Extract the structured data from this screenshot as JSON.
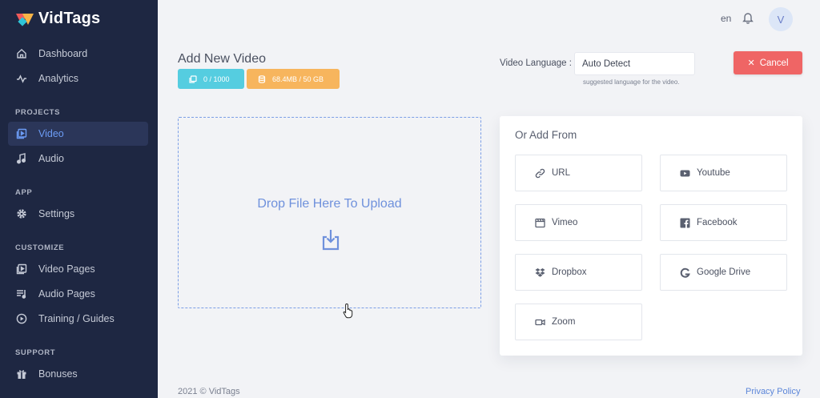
{
  "app": {
    "name": "VidTags"
  },
  "sidebar": {
    "items": [
      {
        "label": "Dashboard",
        "icon": "home-icon"
      },
      {
        "label": "Analytics",
        "icon": "pulse-icon"
      },
      {
        "label": "Video",
        "icon": "video-library-icon",
        "active": true
      },
      {
        "label": "Audio",
        "icon": "music-note-icon"
      },
      {
        "label": "Settings",
        "icon": "gear-icon"
      },
      {
        "label": "Video Pages",
        "icon": "video-pages-icon"
      },
      {
        "label": "Audio Pages",
        "icon": "playlist-icon"
      },
      {
        "label": "Training / Guides",
        "icon": "play-circle-icon"
      },
      {
        "label": "Bonuses",
        "icon": "gift-icon"
      }
    ],
    "sections": {
      "projects": "PROJECTS",
      "app": "APP",
      "customize": "CUSTOMIZE",
      "support": "SUPPORT"
    }
  },
  "topbar": {
    "language_code": "en",
    "avatar_initial": "V"
  },
  "header": {
    "title": "Add New Video",
    "video_count": "0 / 1000",
    "storage": "68.4MB / 50 GB",
    "video_language_label": "Video Language :",
    "video_language_value": "Auto Detect",
    "video_language_hint": "suggested language for the video.",
    "cancel_label": "Cancel"
  },
  "dropzone": {
    "text": "Drop File Here To Upload"
  },
  "add_from": {
    "title": "Or Add From",
    "sources": [
      {
        "label": "URL",
        "icon": "link-icon"
      },
      {
        "label": "Youtube",
        "icon": "youtube-icon"
      },
      {
        "label": "Vimeo",
        "icon": "vimeo-icon"
      },
      {
        "label": "Facebook",
        "icon": "facebook-icon"
      },
      {
        "label": "Dropbox",
        "icon": "dropbox-icon"
      },
      {
        "label": "Google Drive",
        "icon": "google-icon"
      },
      {
        "label": "Zoom",
        "icon": "zoom-camera-icon"
      }
    ]
  },
  "footer": {
    "copyright": "2021 © VidTags",
    "privacy": "Privacy Policy"
  },
  "colors": {
    "sidebar_bg": "#1e2742",
    "accent": "#6c9cf5",
    "count_badge": "#55cde0",
    "storage_badge": "#f7b55d",
    "cancel": "#ef6565"
  }
}
